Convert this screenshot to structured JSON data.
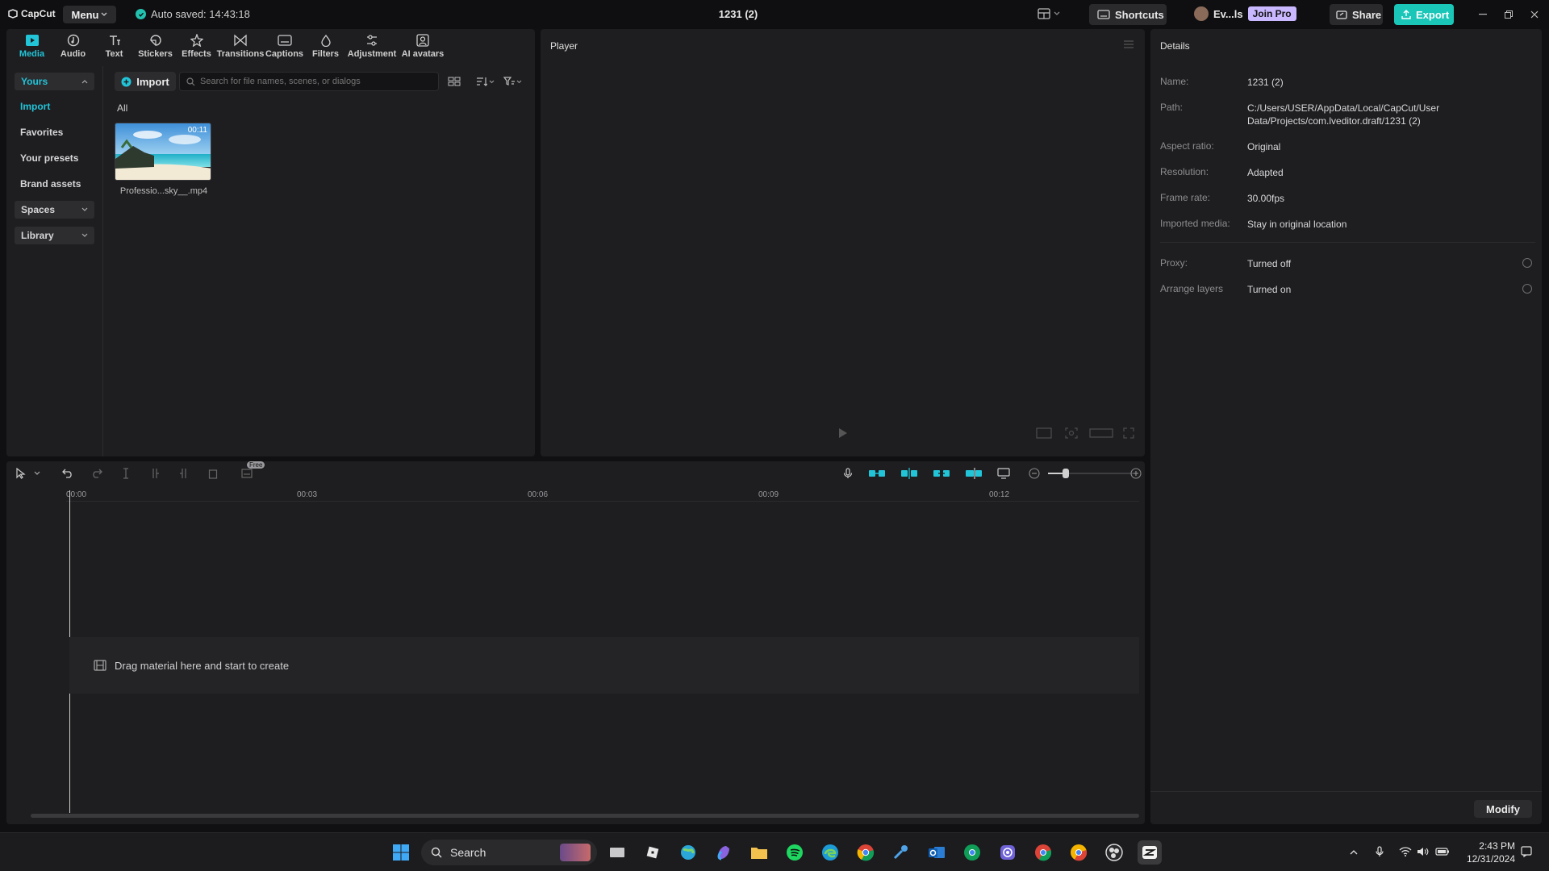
{
  "app": {
    "logo_text": "CapCut",
    "menu_label": "Menu",
    "autosave_text": "Auto saved: 14:43:18",
    "project_title": "1231 (2)",
    "shortcuts_label": "Shortcuts",
    "user_name": "Ev...ls",
    "join_pro_label": "Join Pro",
    "share_label": "Share",
    "export_label": "Export"
  },
  "toolbar": {
    "tools": [
      {
        "label": "Media"
      },
      {
        "label": "Audio"
      },
      {
        "label": "Text"
      },
      {
        "label": "Stickers"
      },
      {
        "label": "Effects"
      },
      {
        "label": "Transitions"
      },
      {
        "label": "Captions"
      },
      {
        "label": "Filters"
      },
      {
        "label": "Adjustment"
      },
      {
        "label": "AI avatars"
      }
    ]
  },
  "sidebar": {
    "yours_label": "Yours",
    "items": [
      {
        "label": "Import"
      },
      {
        "label": "Favorites"
      },
      {
        "label": "Your presets"
      },
      {
        "label": "Brand assets"
      }
    ],
    "spaces_label": "Spaces",
    "library_label": "Library"
  },
  "media": {
    "import_label": "Import",
    "search_placeholder": "Search for file names, scenes, or dialogs",
    "filter_all": "All",
    "items": [
      {
        "duration": "00:11",
        "filename": "Professio...sky__.mp4"
      }
    ]
  },
  "player": {
    "title": "Player"
  },
  "details": {
    "title": "Details",
    "rows": [
      {
        "label": "Name:",
        "value": "1231 (2)"
      },
      {
        "label": "Path:",
        "value": "C:/Users/USER/AppData/Local/CapCut/User Data/Projects/com.lveditor.draft/1231 (2)"
      },
      {
        "label": "Aspect ratio:",
        "value": "Original"
      },
      {
        "label": "Resolution:",
        "value": "Adapted"
      },
      {
        "label": "Frame rate:",
        "value": "30.00fps"
      },
      {
        "label": "Imported media:",
        "value": "Stay in original location"
      }
    ],
    "rows2": [
      {
        "label": "Proxy:",
        "value": "Turned off"
      },
      {
        "label": "Arrange layers",
        "value": "Turned on"
      }
    ],
    "modify_label": "Modify"
  },
  "timeline": {
    "free_badge": "Free",
    "ticks": [
      "00:00",
      "00:03",
      "00:06",
      "00:09",
      "00:12"
    ],
    "drop_hint": "Drag material here and start to create"
  },
  "taskbar": {
    "search_label": "Search",
    "time": "2:43 PM",
    "date": "12/31/2024"
  },
  "colors": {
    "accent": "#22c4d8",
    "export_bg": "#19c6b8",
    "join_pro_bg": "#c9b7ff"
  }
}
